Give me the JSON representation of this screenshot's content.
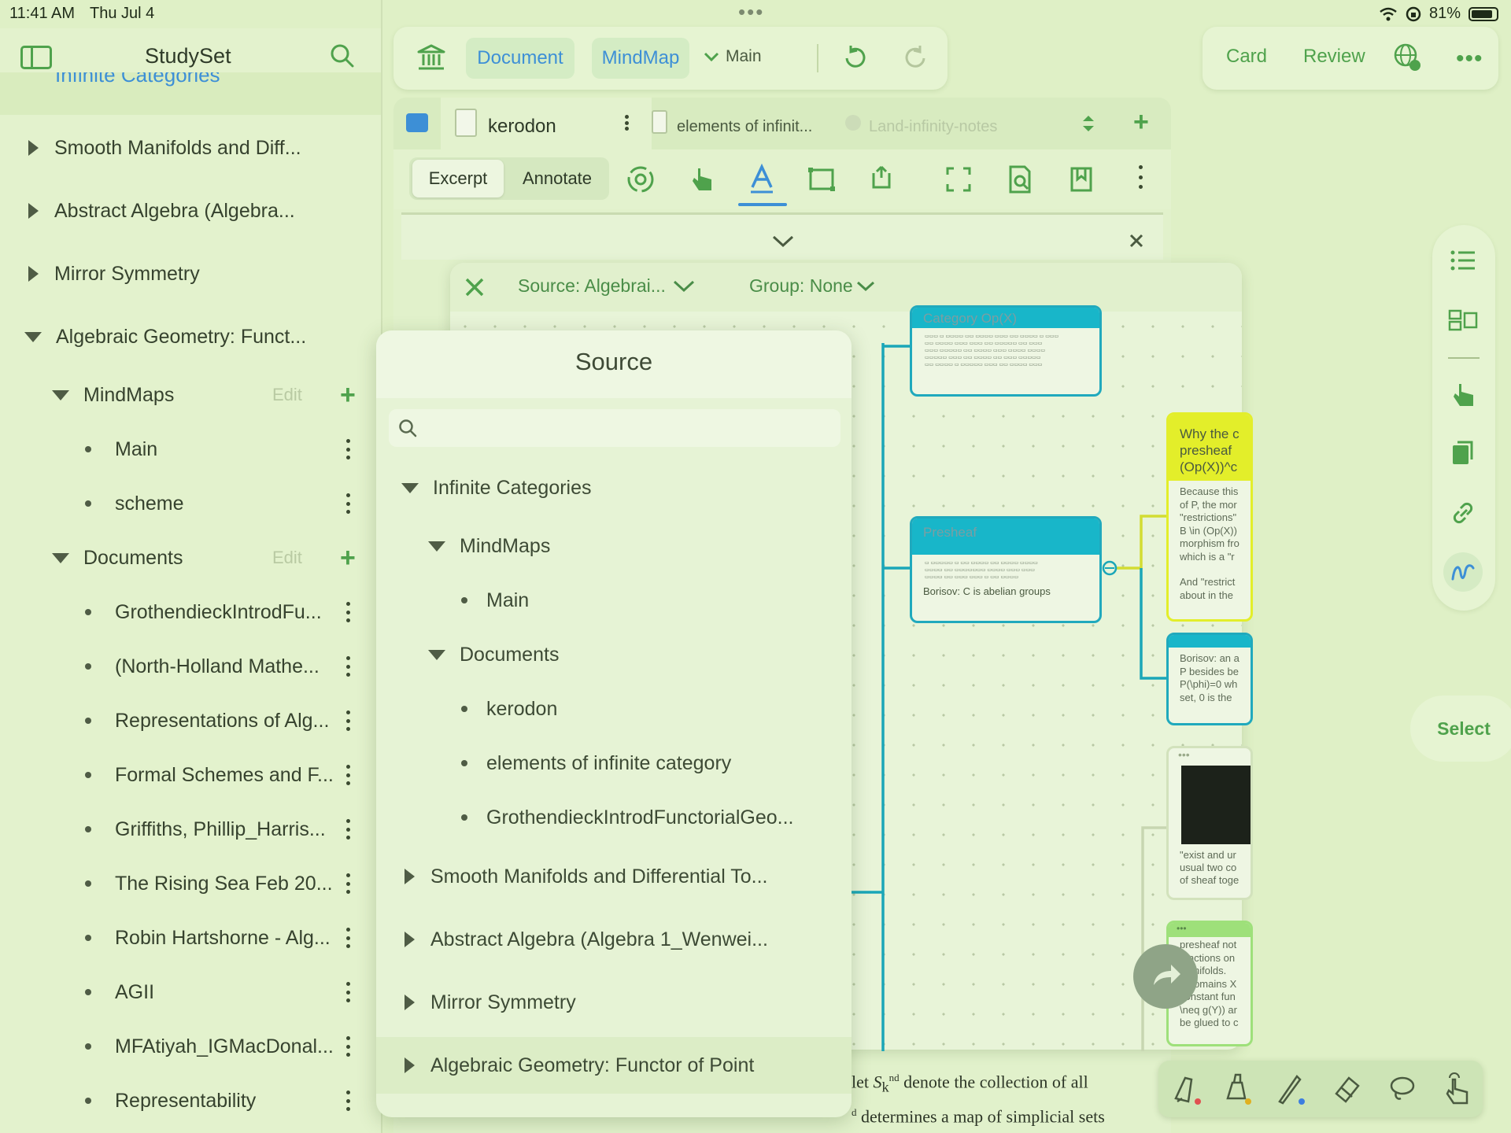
{
  "status_bar": {
    "time": "11:41 AM",
    "date": "Thu Jul 4",
    "battery": "81%"
  },
  "sidebar": {
    "title": "StudySet",
    "partial_item": "Infinite Categories",
    "items": [
      {
        "label": "Smooth Manifolds and Diff..."
      },
      {
        "label": "Abstract Algebra (Algebra..."
      },
      {
        "label": "Mirror Symmetry"
      },
      {
        "label": "Algebraic Geometry: Funct..."
      }
    ],
    "mindmaps_label": "MindMaps",
    "mindmaps_edit": "Edit",
    "mindmaps": [
      "Main",
      "scheme"
    ],
    "documents_label": "Documents",
    "documents_edit": "Edit",
    "documents": [
      "GrothendieckIntrodFu...",
      "(North-Holland Mathe...",
      "Representations of Alg...",
      "Formal Schemes and F...",
      "Griffiths, Phillip_Harris...",
      "The Rising Sea Feb 20...",
      "Robin Hartshorne - Alg...",
      "AGII",
      "MFAtiyah_IGMacDonal...",
      "Representability"
    ]
  },
  "toolbar": {
    "document_label": "Document",
    "mindmap_label": "MindMap",
    "main_dropdown": "Main",
    "card_label": "Card",
    "review_label": "Review"
  },
  "tabs": [
    {
      "label": "kerodon"
    },
    {
      "label": "elements of infinit..."
    },
    {
      "label": "Land-infinity-notes"
    }
  ],
  "doc_tools": {
    "excerpt_label": "Excerpt",
    "annotate_label": "Annotate"
  },
  "mindmap_filter": {
    "source_label": "Source: Algebrai...",
    "group_label": "Group: None"
  },
  "cards": {
    "category_title": "Category Op(X)",
    "presheaf_title": "Presheaf",
    "presheaf_note": "Borisov: C is abelian groups",
    "yellow_title": [
      "Why the c",
      "presheaf",
      "(Op(X))^c"
    ],
    "yellow_body": [
      "Because this",
      "of P, the mor",
      "\"restrictions\"",
      "B \\in (Op(X))",
      "morphism fro",
      "which is a \"r",
      "",
      "And \"restrict",
      "about in the"
    ],
    "borisov_body": [
      "Borisov: an a",
      "P besides be",
      "P(\\phi)=0 wh",
      "set, 0 is the"
    ],
    "exist_body": [
      "\"exist and ur",
      "usual two co",
      "of sheaf toge"
    ],
    "green_body": [
      "presheaf not",
      "functions on",
      "manifolds.",
      "If domains X",
      "constant fun",
      "\\neq g(Y)) ar",
      "be glued to c"
    ]
  },
  "source_popover": {
    "title": "Source",
    "search_placeholder": "",
    "tree": {
      "root": "Infinite Categories",
      "mindmaps": "MindMaps",
      "mindmap_items": [
        "Main"
      ],
      "documents": "Documents",
      "document_items": [
        "kerodon",
        "elements of infinite category",
        "GrothendieckIntrodFunctorialGeo..."
      ],
      "collapsed": [
        "Smooth Manifolds and Differential To...",
        "Abstract Algebra (Algebra 1_Wenwei...",
        "Mirror Symmetry"
      ],
      "selected": "Algebraic Geometry: Functor of Point"
    }
  },
  "right_rail": {
    "select_label": "Select"
  },
  "doc_text": {
    "line1_pre": "let",
    "line1_post": "denote the collection of all",
    "line2": "determines a map of simplicial sets"
  },
  "colors": {
    "accent_green": "#4fa24c",
    "accent_blue": "#3d8fd6",
    "card_cyan": "#18b6c9",
    "card_yellow": "#e3ee2a"
  }
}
